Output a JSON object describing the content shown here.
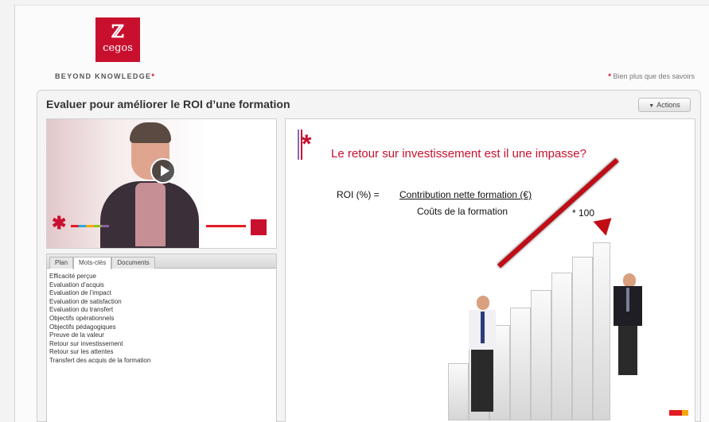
{
  "brand": {
    "logo_mark": "ℤ",
    "logo_text": "cegos",
    "tagline": "BEYOND KNOWLEDGE",
    "tagline_star": "*",
    "slogan_star": "*",
    "slogan": "Bien plus que des savoirs",
    "colors": {
      "red": "#c8102e",
      "purple": "#8a68a6"
    }
  },
  "course": {
    "title": "Evaluer pour améliorer le ROI d’une formation",
    "actions_label": "Actions"
  },
  "video": {
    "play_icon": "play-icon"
  },
  "tabs": [
    {
      "label": "Plan",
      "active": false
    },
    {
      "label": "Mots-clés",
      "active": true
    },
    {
      "label": "Documents",
      "active": false
    }
  ],
  "keywords": [
    "Efficacité perçue",
    "Evaluation d’acquis",
    "Evaluation de l’impact",
    "Evaluation de satisfaction",
    "Evaluation du transfert",
    "Objectifs opérationnels",
    "Objectifs pédagogiques",
    "Preuve de la valeur",
    "Retour sur investissement",
    "Retour sur les attentes",
    "Transfert des acquis de la formation"
  ],
  "slide": {
    "asterisk": "*",
    "heading": "Le retour sur investissement est il une impasse?",
    "roi_label": "ROI (%) =",
    "roi_numerator": "Contribution nette formation (€)",
    "roi_denominator": "Coûts de la formation",
    "roi_multiplier": "* 100"
  }
}
